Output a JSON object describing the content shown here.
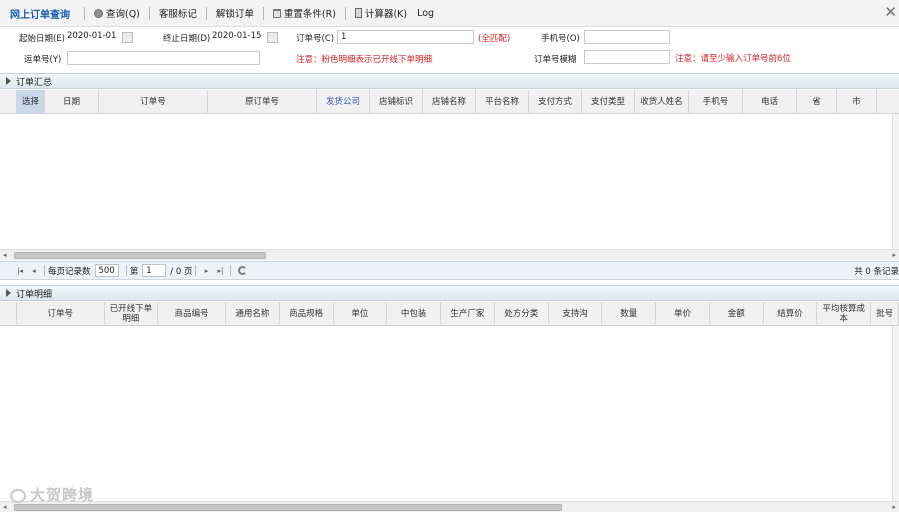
{
  "toolbar": {
    "title": "网上订单查询",
    "query": "查询(Q)",
    "cs_mark": "客服标记",
    "unlock": "解锁订单",
    "reset": "重置条件(R)",
    "calculator": "计算器(K)",
    "log": "Log",
    "close": "✕"
  },
  "filters": {
    "start_date_label": "起始日期(E)",
    "start_date": "2020-01-01",
    "end_date_label": "终止日期(D)",
    "end_date": "2020-01-15",
    "order_no_label": "订单号(C)",
    "order_no": "1",
    "full_match": "(全匹配)",
    "phone_label": "手机号(O)",
    "phone": "",
    "waybill_label": "运单号(Y)",
    "waybill": "",
    "note_pink": "注意：粉色明细表示已开线下单明细",
    "order_fuzzy_label": "订单号模糊",
    "order_fuzzy": "",
    "note_min": "注意：请至少输入订单号前6位"
  },
  "summary": {
    "title": "订单汇总",
    "columns": [
      "选择",
      "日期",
      "订单号",
      "原订单号",
      "发货公司",
      "店铺标识",
      "店铺名称",
      "平台名称",
      "支付方式",
      "支付类型",
      "收货人姓名",
      "手机号",
      "电话",
      "省",
      "市"
    ],
    "rows": []
  },
  "pager": {
    "page_size_label": "每页记录数",
    "page_size": "500",
    "page_prefix": "第",
    "page": "1",
    "page_suffix": "/ 0 页",
    "total": "共 0 条记录"
  },
  "detail": {
    "title": "订单明细",
    "columns": [
      "订单号",
      "已开线下单明细",
      "商品编号",
      "通用名称",
      "商品规格",
      "单位",
      "中包装",
      "生产厂家",
      "处方分类",
      "支持沟",
      "数量",
      "单价",
      "金额",
      "结算价",
      "平均核算成本",
      "批号"
    ],
    "rows": []
  },
  "watermark": "大贺跨境",
  "colors": {
    "title_blue": "#1a5fb4",
    "note_red": "#d42020",
    "header_blue": "#2f56b5"
  }
}
